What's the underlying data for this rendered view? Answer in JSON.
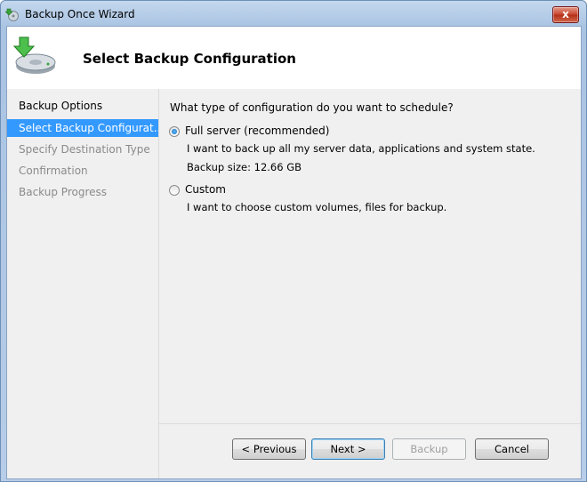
{
  "window": {
    "title": "Backup Once Wizard",
    "close_label": "x"
  },
  "header": {
    "title": "Select Backup Configuration"
  },
  "sidebar": {
    "items": [
      {
        "label": "Backup Options",
        "state": "done"
      },
      {
        "label": "Select Backup Configurat...",
        "state": "active"
      },
      {
        "label": "Specify Destination Type",
        "state": "pending"
      },
      {
        "label": "Confirmation",
        "state": "pending"
      },
      {
        "label": "Backup Progress",
        "state": "pending"
      }
    ]
  },
  "main": {
    "question": "What type of configuration do you want to schedule?",
    "options": [
      {
        "label": "Full server (recommended)",
        "description": "I want to back up all my server data, applications and system state.",
        "size_text": "Backup size: 12.66 GB",
        "selected": true
      },
      {
        "label": "Custom",
        "description": "I want to choose custom volumes, files for backup.",
        "selected": false
      }
    ]
  },
  "buttons": {
    "previous": "< Previous",
    "next": "Next >",
    "backup": "Backup",
    "cancel": "Cancel"
  },
  "colors": {
    "selection": "#3399ff",
    "window_frame": "#b7cde8",
    "close_button": "#c7432c"
  },
  "icons": {
    "title": "backup-wizard-icon",
    "header": "disk-backup-icon"
  }
}
